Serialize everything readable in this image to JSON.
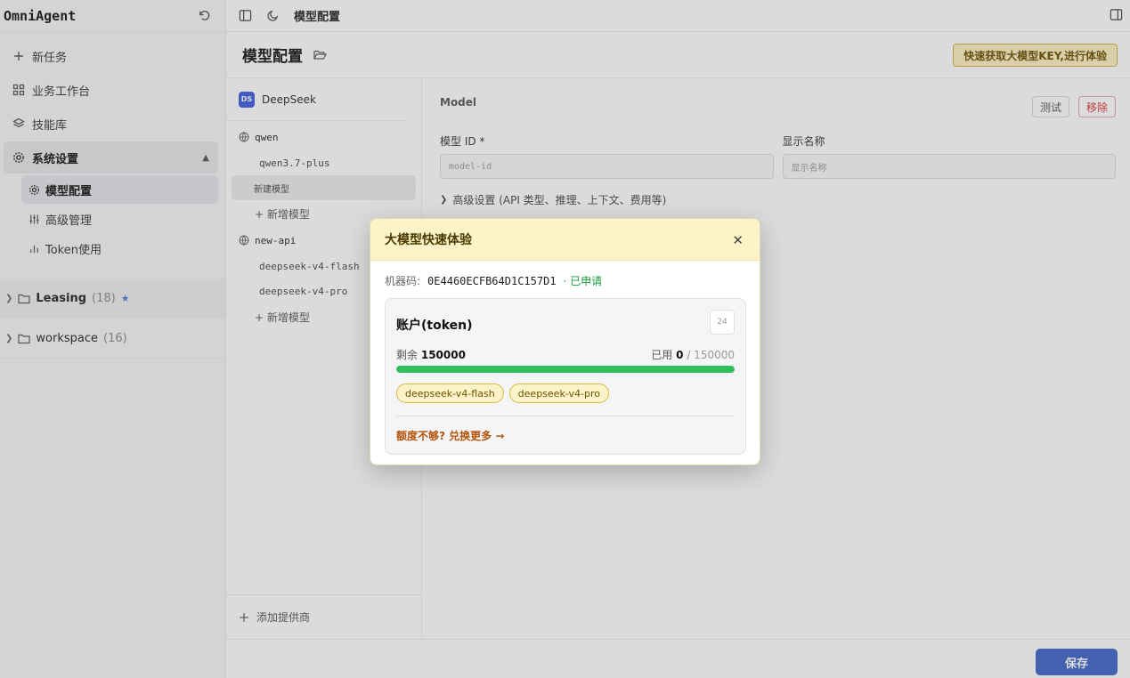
{
  "app": {
    "name": "OmniAgent"
  },
  "sidebar": {
    "nav": [
      {
        "label": "新任务",
        "icon": "plus-icon"
      },
      {
        "label": "业务工作台",
        "icon": "grid-icon"
      },
      {
        "label": "技能库",
        "icon": "layers-icon"
      },
      {
        "label": "系统设置",
        "icon": "gear-icon"
      }
    ],
    "sub": [
      {
        "label": "模型配置"
      },
      {
        "label": "高级管理"
      },
      {
        "label": "Token使用"
      }
    ],
    "workspaces": [
      {
        "name": "Leasing",
        "count": "(18)",
        "star": "★"
      },
      {
        "name": "workspace",
        "count": "(16)"
      }
    ]
  },
  "topbar": {
    "crumb": "模型配置"
  },
  "page": {
    "title": "模型配置",
    "promo_button": "快速获取大模型KEY,进行体验"
  },
  "providers": {
    "head": {
      "badge": "DS",
      "name": "DeepSeek"
    },
    "groups": [
      {
        "name": "qwen",
        "models": [
          "qwen3.7-plus",
          "新建模型"
        ],
        "add": "+ 新增模型"
      },
      {
        "name": "new-api",
        "models": [
          "deepseek-v4-flash",
          "deepseek-v4-pro"
        ],
        "add": "+ 新增模型"
      }
    ],
    "add_provider": "添加提供商"
  },
  "detail": {
    "title": "Model",
    "test_button": "测试",
    "remove_button": "移除",
    "model_id_label": "模型 ID *",
    "model_id_placeholder": "model-id",
    "display_name_label": "显示名称",
    "display_name_placeholder": "显示名称",
    "advanced": "高级设置 (API 类型、推理、上下文、费用等)"
  },
  "footer": {
    "save": "保存"
  },
  "modal": {
    "title": "大模型快速体验",
    "close": "✕",
    "machine_label": "机器码:",
    "machine_code": "0E4460ECFB64D1C157D1",
    "machine_status": "· 已申请",
    "card": {
      "title": "账户(token)",
      "badge": "24",
      "remaining_label": "剩余",
      "remaining_value": "150000",
      "used_label": "已用",
      "used_value": "0",
      "total": "/ 150000",
      "progress_fraction": 1.0,
      "chips": [
        "deepseek-v4-flash",
        "deepseek-v4-pro"
      ],
      "more_link": "额度不够? 兑换更多 →"
    }
  },
  "colors": {
    "accent": "#3b63c4",
    "success": "#2fbf5a",
    "warning_bg": "#fdf3c8",
    "danger": "#d33333"
  }
}
